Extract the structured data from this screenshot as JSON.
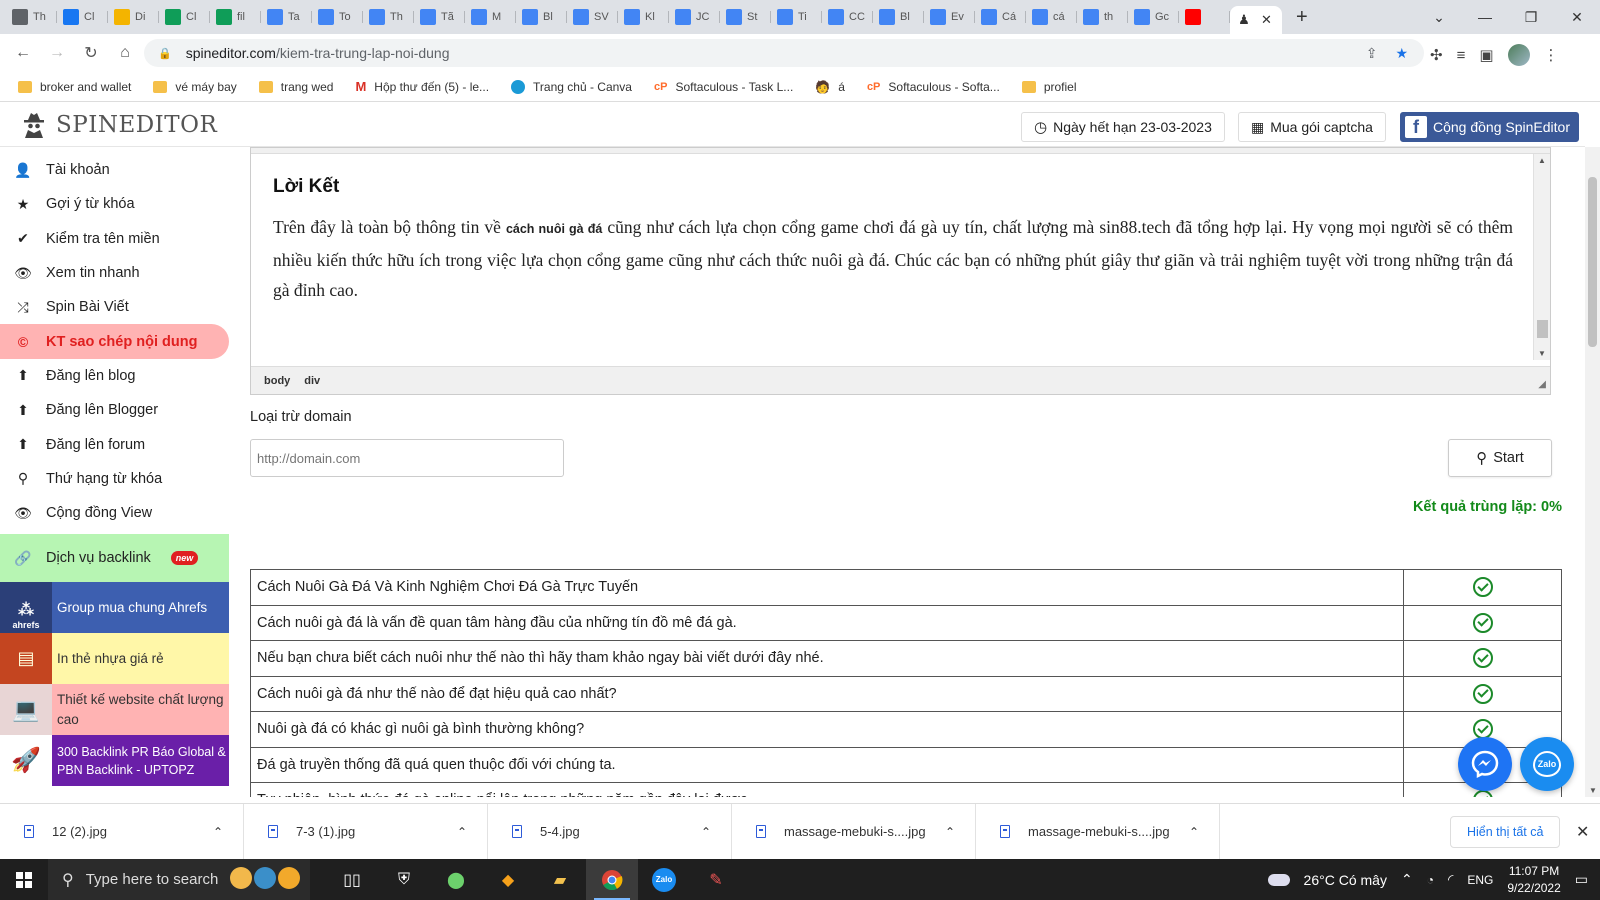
{
  "tabs": [
    {
      "label": "Th",
      "favicon": "chrome-icon",
      "color": "#5f6368"
    },
    {
      "label": "Cl",
      "favicon": "facebook-icon",
      "color": "#1877f2"
    },
    {
      "label": "Di",
      "favicon": "drive-icon",
      "color": "#f4b400"
    },
    {
      "label": "Cl",
      "favicon": "sheets-icon",
      "color": "#0f9d58"
    },
    {
      "label": "fil",
      "favicon": "sheets-icon",
      "color": "#0f9d58"
    },
    {
      "label": "Ta",
      "favicon": "docs-icon",
      "color": "#4285f4"
    },
    {
      "label": "To",
      "favicon": "docs-icon",
      "color": "#4285f4"
    },
    {
      "label": "Th",
      "favicon": "docs-icon",
      "color": "#4285f4"
    },
    {
      "label": "Tã",
      "favicon": "docs-icon",
      "color": "#4285f4"
    },
    {
      "label": "M",
      "favicon": "docs-icon",
      "color": "#4285f4"
    },
    {
      "label": "Bl",
      "favicon": "docs-icon",
      "color": "#4285f4"
    },
    {
      "label": "SV",
      "favicon": "docs-icon",
      "color": "#4285f4"
    },
    {
      "label": "Kl",
      "favicon": "docs-icon",
      "color": "#4285f4"
    },
    {
      "label": "JC",
      "favicon": "docs-icon",
      "color": "#4285f4"
    },
    {
      "label": "St",
      "favicon": "docs-icon",
      "color": "#4285f4"
    },
    {
      "label": "Ti",
      "favicon": "docs-icon",
      "color": "#4285f4"
    },
    {
      "label": "CC",
      "favicon": "docs-icon",
      "color": "#4285f4"
    },
    {
      "label": "Bl",
      "favicon": "docs-icon",
      "color": "#4285f4"
    },
    {
      "label": "Ev",
      "favicon": "docs-icon",
      "color": "#4285f4"
    },
    {
      "label": "Cá",
      "favicon": "docs-icon",
      "color": "#4285f4"
    },
    {
      "label": "cá",
      "favicon": "docs-icon",
      "color": "#4285f4"
    },
    {
      "label": "th",
      "favicon": "docs-icon",
      "color": "#4285f4"
    },
    {
      "label": "Gc",
      "favicon": "translate-icon",
      "color": "#4285f4"
    },
    {
      "label": "",
      "favicon": "youtube-icon",
      "color": "#ff0000"
    }
  ],
  "address": {
    "host": "spineditor.com",
    "path": "/kiem-tra-trung-lap-noi-dung"
  },
  "bookmarks": [
    {
      "label": "broker and wallet",
      "icon": "folder-icon"
    },
    {
      "label": "vé máy bay",
      "icon": "folder-icon"
    },
    {
      "label": "trang wed",
      "icon": "folder-icon"
    },
    {
      "label": "Hộp thư đến (5) - le...",
      "icon": "gmail-icon"
    },
    {
      "label": "Trang chủ - Canva",
      "icon": "canva-icon"
    },
    {
      "label": "Softaculous - Task L...",
      "icon": "cpanel-icon"
    },
    {
      "label": "á",
      "icon": "avatar-icon"
    },
    {
      "label": "Softaculous - Softa...",
      "icon": "cpanel-icon"
    },
    {
      "label": "profiel",
      "icon": "folder-icon"
    }
  ],
  "header": {
    "logo": "SPINEDITOR",
    "expiry": "Ngày hết hạn 23-03-2023",
    "captcha": "Mua gói captcha",
    "community": "Cộng đồng SpinEditor"
  },
  "sidebar": {
    "items": [
      {
        "label": "Tài khoản",
        "icon": "user-icon",
        "glyph": "👤"
      },
      {
        "label": "Gợi ý từ khóa",
        "icon": "star-icon",
        "glyph": "★"
      },
      {
        "label": "Kiểm tra tên miền",
        "icon": "check-icon",
        "glyph": "✔"
      },
      {
        "label": "Xem tin nhanh",
        "icon": "eye-icon",
        "glyph": "👁"
      },
      {
        "label": "Spin Bài Viết",
        "icon": "shuffle-icon",
        "glyph": "⤮"
      },
      {
        "label": "KT sao chép nội dung",
        "icon": "copyright-icon",
        "glyph": "©"
      },
      {
        "label": "Đăng lên blog",
        "icon": "upload-icon",
        "glyph": "⬆"
      },
      {
        "label": "Đăng lên Blogger",
        "icon": "upload-icon",
        "glyph": "⬆"
      },
      {
        "label": "Đăng lên forum",
        "icon": "upload-icon",
        "glyph": "⬆"
      },
      {
        "label": "Thứ hạng từ khóa",
        "icon": "search-icon",
        "glyph": "⚲"
      },
      {
        "label": "Cộng đồng View",
        "icon": "eye-icon",
        "glyph": "👁"
      }
    ],
    "backlink": {
      "label": "Dịch vụ backlink",
      "badge": "new"
    },
    "promos": [
      {
        "label": "Group mua chung Ahrefs",
        "bg": "#3d5fb0",
        "fg": "#ffffff",
        "thumb": "ahrefs"
      },
      {
        "label": "In thẻ nhựa giá rẻ",
        "bg": "#fff7a8",
        "fg": "#333333",
        "thumb": "cards"
      },
      {
        "label": "Thiết kế website chất lượng cao",
        "bg": "#ffb3b3",
        "fg": "#333333",
        "thumb": "web"
      },
      {
        "label": "300 Backlink PR Báo Global & PBN Backlink - UPTOPZ",
        "bg": "#6a1fa8",
        "fg": "#ffffff",
        "thumb": "rocket"
      }
    ]
  },
  "editor": {
    "heading": "Lời Kết",
    "para_before": "Trên đây là toàn bộ thông tin về ",
    "para_bold": "cách nuôi gà đá",
    "para_after": " cũng như cách lựa chọn cổng game chơi đá gà uy tín, chất lượng mà sin88.tech đã tổng hợp lại. Hy vọng mọi người sẽ có thêm nhiều kiến thức hữu ích trong việc lựa chọn cổng game cũng như cách thức nuôi gà đá. Chúc các bạn có những phút giây thư giãn và trải nghiệm tuyệt vời trong những trận đá gà đỉnh cao.",
    "path": [
      "body",
      "div"
    ]
  },
  "form": {
    "exclude_label": "Loại trừ domain",
    "domain_placeholder": "http://domain.com",
    "start_label": "Start",
    "result": "Kết quả trùng lặp: 0%"
  },
  "results": [
    "Cách Nuôi Gà Đá Và Kinh Nghiệm Chơi Đá Gà Trực Tuyến",
    "Cách nuôi gà đá là vấn đề quan tâm hàng đầu của những tín đồ mê đá gà.",
    "Nếu bạn chưa biết cách nuôi như thế nào thì hãy tham khảo ngay bài viết dưới đây nhé.",
    "Cách nuôi gà đá như thế nào để đạt hiệu quả cao nhất?",
    "Nuôi gà đá có khác gì nuôi gà bình thường không?",
    "Đá gà truyền thống đã quá quen thuộc đối với chúng ta.",
    "Tuy nhiên, hình thức đá gà online nổi lên trong những năm gần đây lại được"
  ],
  "downloads": [
    {
      "name": "12 (2).jpg"
    },
    {
      "name": "7-3 (1).jpg"
    },
    {
      "name": "5-4.jpg"
    },
    {
      "name": "massage-mebuki-s....jpg"
    },
    {
      "name": "massage-mebuki-s....jpg"
    }
  ],
  "downloads_show_all": "Hiển thị tất cả",
  "taskbar": {
    "search": "Type here to search",
    "weather": "26°C  Có mây",
    "lang": "ENG",
    "time": "11:07 PM",
    "date": "9/22/2022"
  }
}
